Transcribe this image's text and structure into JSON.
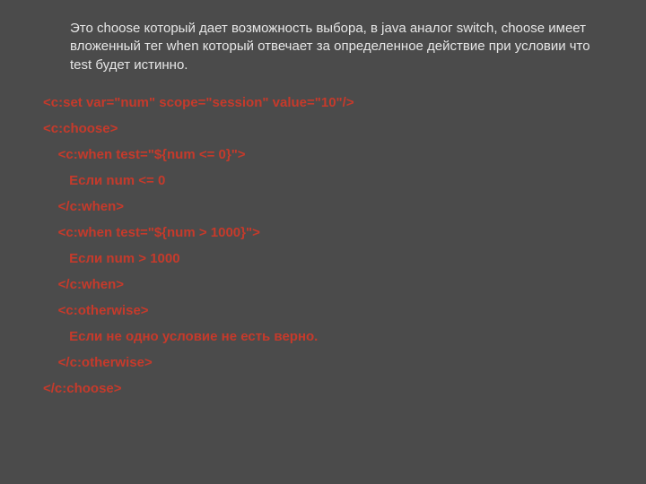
{
  "description": "Это choose который дает возможность выбора, в java аналог switch, choose имеет вложенный тег when  который отвечает за определенное действие при условии что test будет истинно.",
  "code": {
    "l01": "<c:set var=\"num\" scope=\"session\" value=\"10\"/>",
    "l02": "<c:choose>",
    "l03": "    <c:when test=\"${num <= 0}\">",
    "l04": "       Если num <= 0",
    "l05": "    </c:when>",
    "l06": "    <c:when test=\"${num > 1000}\">",
    "l07": "       Если num > 1000",
    "l08": "    </c:when>",
    "l09": "    <c:otherwise>",
    "l10": "       Если не одно условие не есть верно.",
    "l11": "    </c:otherwise>",
    "l12": "</c:choose>"
  }
}
